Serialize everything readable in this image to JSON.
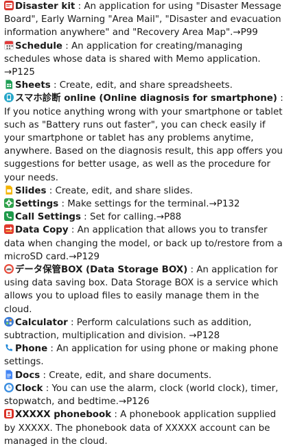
{
  "entries": [
    {
      "icon": "disaster-kit-icon",
      "name": "Disaster kit",
      "text": " : An application for using \"Disaster Message Board\", Early Warning \"Area Mail\", \"Disaster and evacuation information anywhere\" and \"Recovery Area Map\".→P99"
    },
    {
      "icon": "calendar-icon",
      "name": "Schedule",
      "text": " : An application for creating/managing schedules whose data is shared with Memo application. →P125"
    },
    {
      "icon": "sheets-icon",
      "name": "Sheets",
      "text": " : Create, edit, and share spreadsheets."
    },
    {
      "icon": "diagnosis-icon",
      "name": "スマホ診断 online (Online diagnosis for smartphone)",
      "text": " : If you notice anything wrong with your smartphone or tablet such as \"Battery runs out faster\",  you can check easily if your smartphone or tablet has any problems anytime, anywhere. Based on the diagnosis result, this app offers you suggestions for better usage, as well as the procedure for your needs."
    },
    {
      "icon": "slides-icon",
      "name": "Slides",
      "text": " : Create, edit, and share slides."
    },
    {
      "icon": "gear-icon",
      "name": "Settings",
      "text": " : Make settings for the terminal.→P132"
    },
    {
      "icon": "call-settings-icon",
      "name": "Call Settings",
      "text": " : Set for calling.→P88"
    },
    {
      "icon": "data-copy-icon",
      "name": "Data Copy",
      "text": " : An application that allows you to transfer data when changing the model, or back up to/restore from a microSD card.→P129"
    },
    {
      "icon": "storage-box-icon",
      "name": "データ保管BOX (Data Storage BOX)",
      "text": " : An application for using data saving box. Data Storage BOX is a service which allows you to upload files to easily manage them in the cloud."
    },
    {
      "icon": "calculator-icon",
      "name": "Calculator",
      "text": " : Perform calculations such as addition, subtraction, multiplication and division. →P128"
    },
    {
      "icon": "phone-icon",
      "name": "Phone",
      "text": " : An application for using phone or making phone settings."
    },
    {
      "icon": "docs-icon",
      "name": "Docs",
      "text": " : Create, edit, and share documents."
    },
    {
      "icon": "clock-icon",
      "name": "Clock",
      "text": " : You can use the alarm, clock (world clock), timer, stopwatch, and bedtime.→P126"
    },
    {
      "icon": "phonebook-icon",
      "name": "XXXXX phonebook",
      "text": " : A phonebook application supplied by XXXXX. The phonebook data of XXXXX account can be managed in the cloud."
    }
  ],
  "colors": {
    "text": "#1a1a1a",
    "disaster": "#d9342b",
    "calendar": "#e23a3a",
    "sheets": "#1e9e55",
    "diagnosis": "#27a7c9",
    "slides": "#f4b400",
    "settings": "#2fa14a",
    "call_settings": "#1f9a4b",
    "data_copy": "#e0392f",
    "storage": "#e74c3c",
    "calculator": "#3a7bd5",
    "phone": "#1f86d6",
    "docs": "#4285f4",
    "clock": "#3b8ee0",
    "phonebook": "#d93025"
  }
}
